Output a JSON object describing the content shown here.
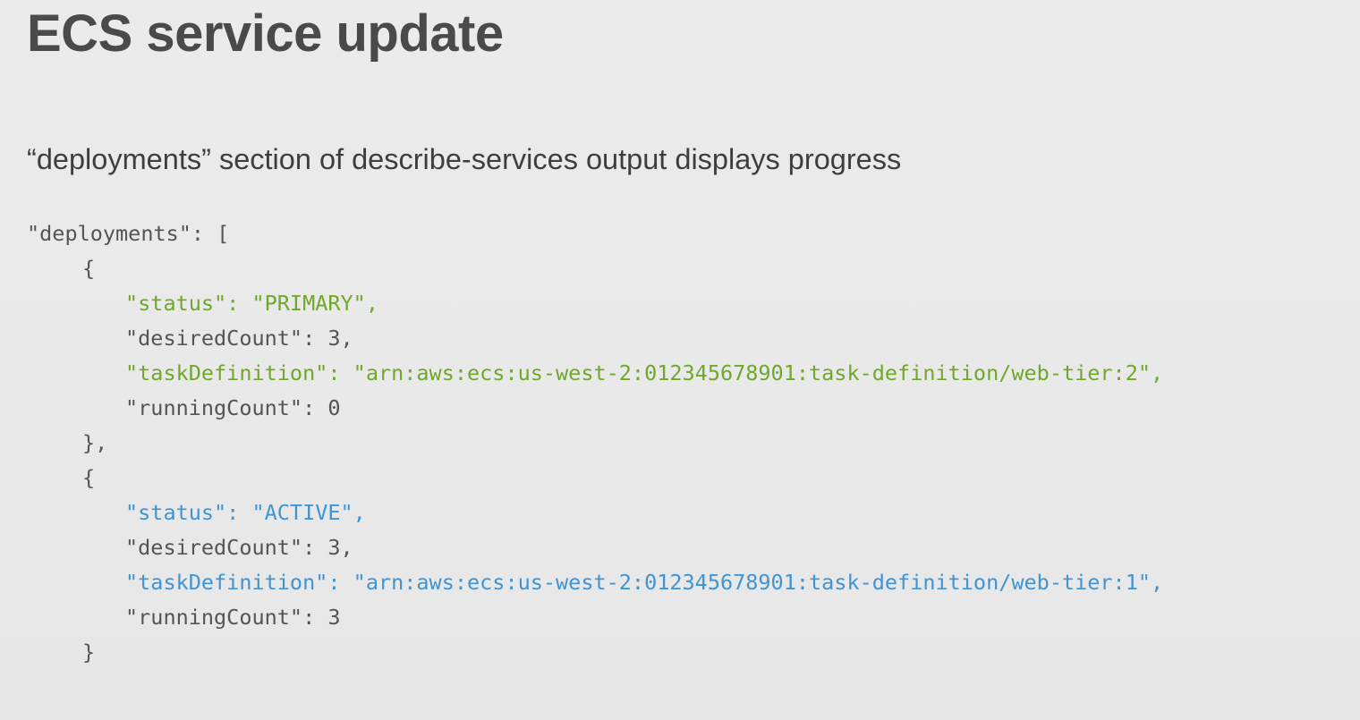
{
  "slide": {
    "title": "ECS service update",
    "subtitle": "“deployments” section of describe-services output displays progress"
  },
  "colors": {
    "background": "#e9e9e9",
    "title": "#4a4a4a",
    "code_plain": "#555555",
    "primary_deployment": "#6fa82a",
    "active_deployment": "#3f94d4"
  },
  "code": {
    "lines": [
      {
        "text": "\"deployments\": [",
        "indent": 0,
        "style": "plain"
      },
      {
        "text": "{",
        "indent": 1,
        "style": "plain"
      },
      {
        "text": "\"status\": \"PRIMARY\",",
        "indent": 2,
        "style": "green"
      },
      {
        "text": "\"desiredCount\": 3,",
        "indent": 2,
        "style": "plain"
      },
      {
        "text": "\"taskDefinition\": \"arn:aws:ecs:us-west-2:012345678901:task-definition/web-tier:2\",",
        "indent": 2,
        "style": "green"
      },
      {
        "text": "\"runningCount\": 0",
        "indent": 2,
        "style": "plain"
      },
      {
        "text": "},",
        "indent": 1,
        "style": "plain"
      },
      {
        "text": "{",
        "indent": 1,
        "style": "plain"
      },
      {
        "text": "\"status\": \"ACTIVE\",",
        "indent": 2,
        "style": "blue"
      },
      {
        "text": "\"desiredCount\": 3,",
        "indent": 2,
        "style": "plain"
      },
      {
        "text": "\"taskDefinition\": \"arn:aws:ecs:us-west-2:012345678901:task-definition/web-tier:1\",",
        "indent": 2,
        "style": "blue"
      },
      {
        "text": "\"runningCount\": 3",
        "indent": 2,
        "style": "plain"
      },
      {
        "text": "}",
        "indent": 1,
        "style": "plain"
      }
    ]
  }
}
